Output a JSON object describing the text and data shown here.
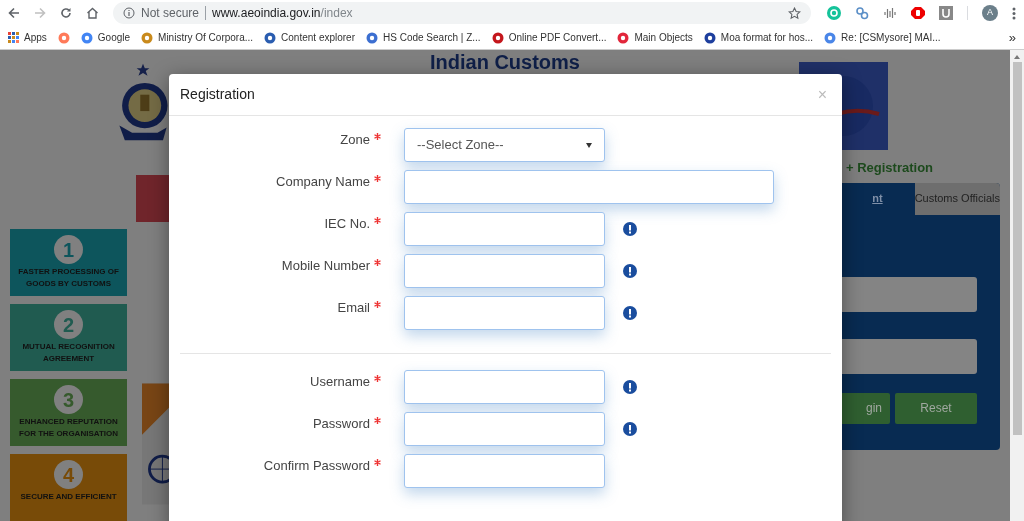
{
  "browser": {
    "security": "Not secure",
    "url_host": "www.aeoindia.gov.in",
    "url_path": "/index",
    "profile_initial": "A",
    "more": "»",
    "bookmarks": [
      {
        "kind": "apps",
        "label": "Apps"
      },
      {
        "kind": "icon"
      },
      {
        "kind": "link",
        "label": "Google"
      },
      {
        "label": "Ministry Of Corpora..."
      },
      {
        "label": "Content explorer"
      },
      {
        "label": "HS Code Search | Z..."
      },
      {
        "label": "Online PDF Convert..."
      },
      {
        "label": "Main Objects"
      },
      {
        "label": "Moa format for hos..."
      },
      {
        "label": "Re: [CSMysore] MAI..."
      }
    ]
  },
  "page": {
    "heading": "Indian Customs",
    "side_title": "+ Registration",
    "benefits": [
      {
        "number": "1",
        "label": "FASTER PROCESSING OF GOODS BY CUSTOMS",
        "color": "#0d555c"
      },
      {
        "number": "2",
        "label": "MUTUAL RECOGNITION AGREEMENT",
        "color": "#205b50"
      },
      {
        "number": "3",
        "label": "ENHANCED REPUTATION FOR THE ORGANISATION",
        "color": "#365a2d"
      },
      {
        "number": "4",
        "label": "SECURE AND EFFICIENT",
        "color": "#784b08"
      }
    ],
    "tabs": [
      {
        "label": "nt",
        "selected": true
      },
      {
        "label": "Customs Officials",
        "selected": false
      }
    ],
    "buttons": [
      "gin",
      "Reset"
    ]
  },
  "modal": {
    "title": "Registration",
    "close": "×",
    "fields": [
      {
        "label": "Zone",
        "required": true,
        "kind": "select",
        "placeholder": "--Select Zone--",
        "info": false
      },
      {
        "label": "Company Name",
        "required": true,
        "kind": "long",
        "info": false
      },
      {
        "label": "IEC No.",
        "required": true,
        "kind": "short",
        "info": true
      },
      {
        "label": "Mobile Number",
        "required": true,
        "kind": "short",
        "info": true
      },
      {
        "label": "Email",
        "required": true,
        "kind": "short",
        "info": true
      }
    ],
    "account_fields": [
      {
        "label": "Username",
        "required": true,
        "kind": "short",
        "info": true
      },
      {
        "label": "Password",
        "required": true,
        "kind": "short",
        "info": true
      },
      {
        "label": "Confirm Password",
        "required": true,
        "kind": "short",
        "info": false
      }
    ]
  }
}
